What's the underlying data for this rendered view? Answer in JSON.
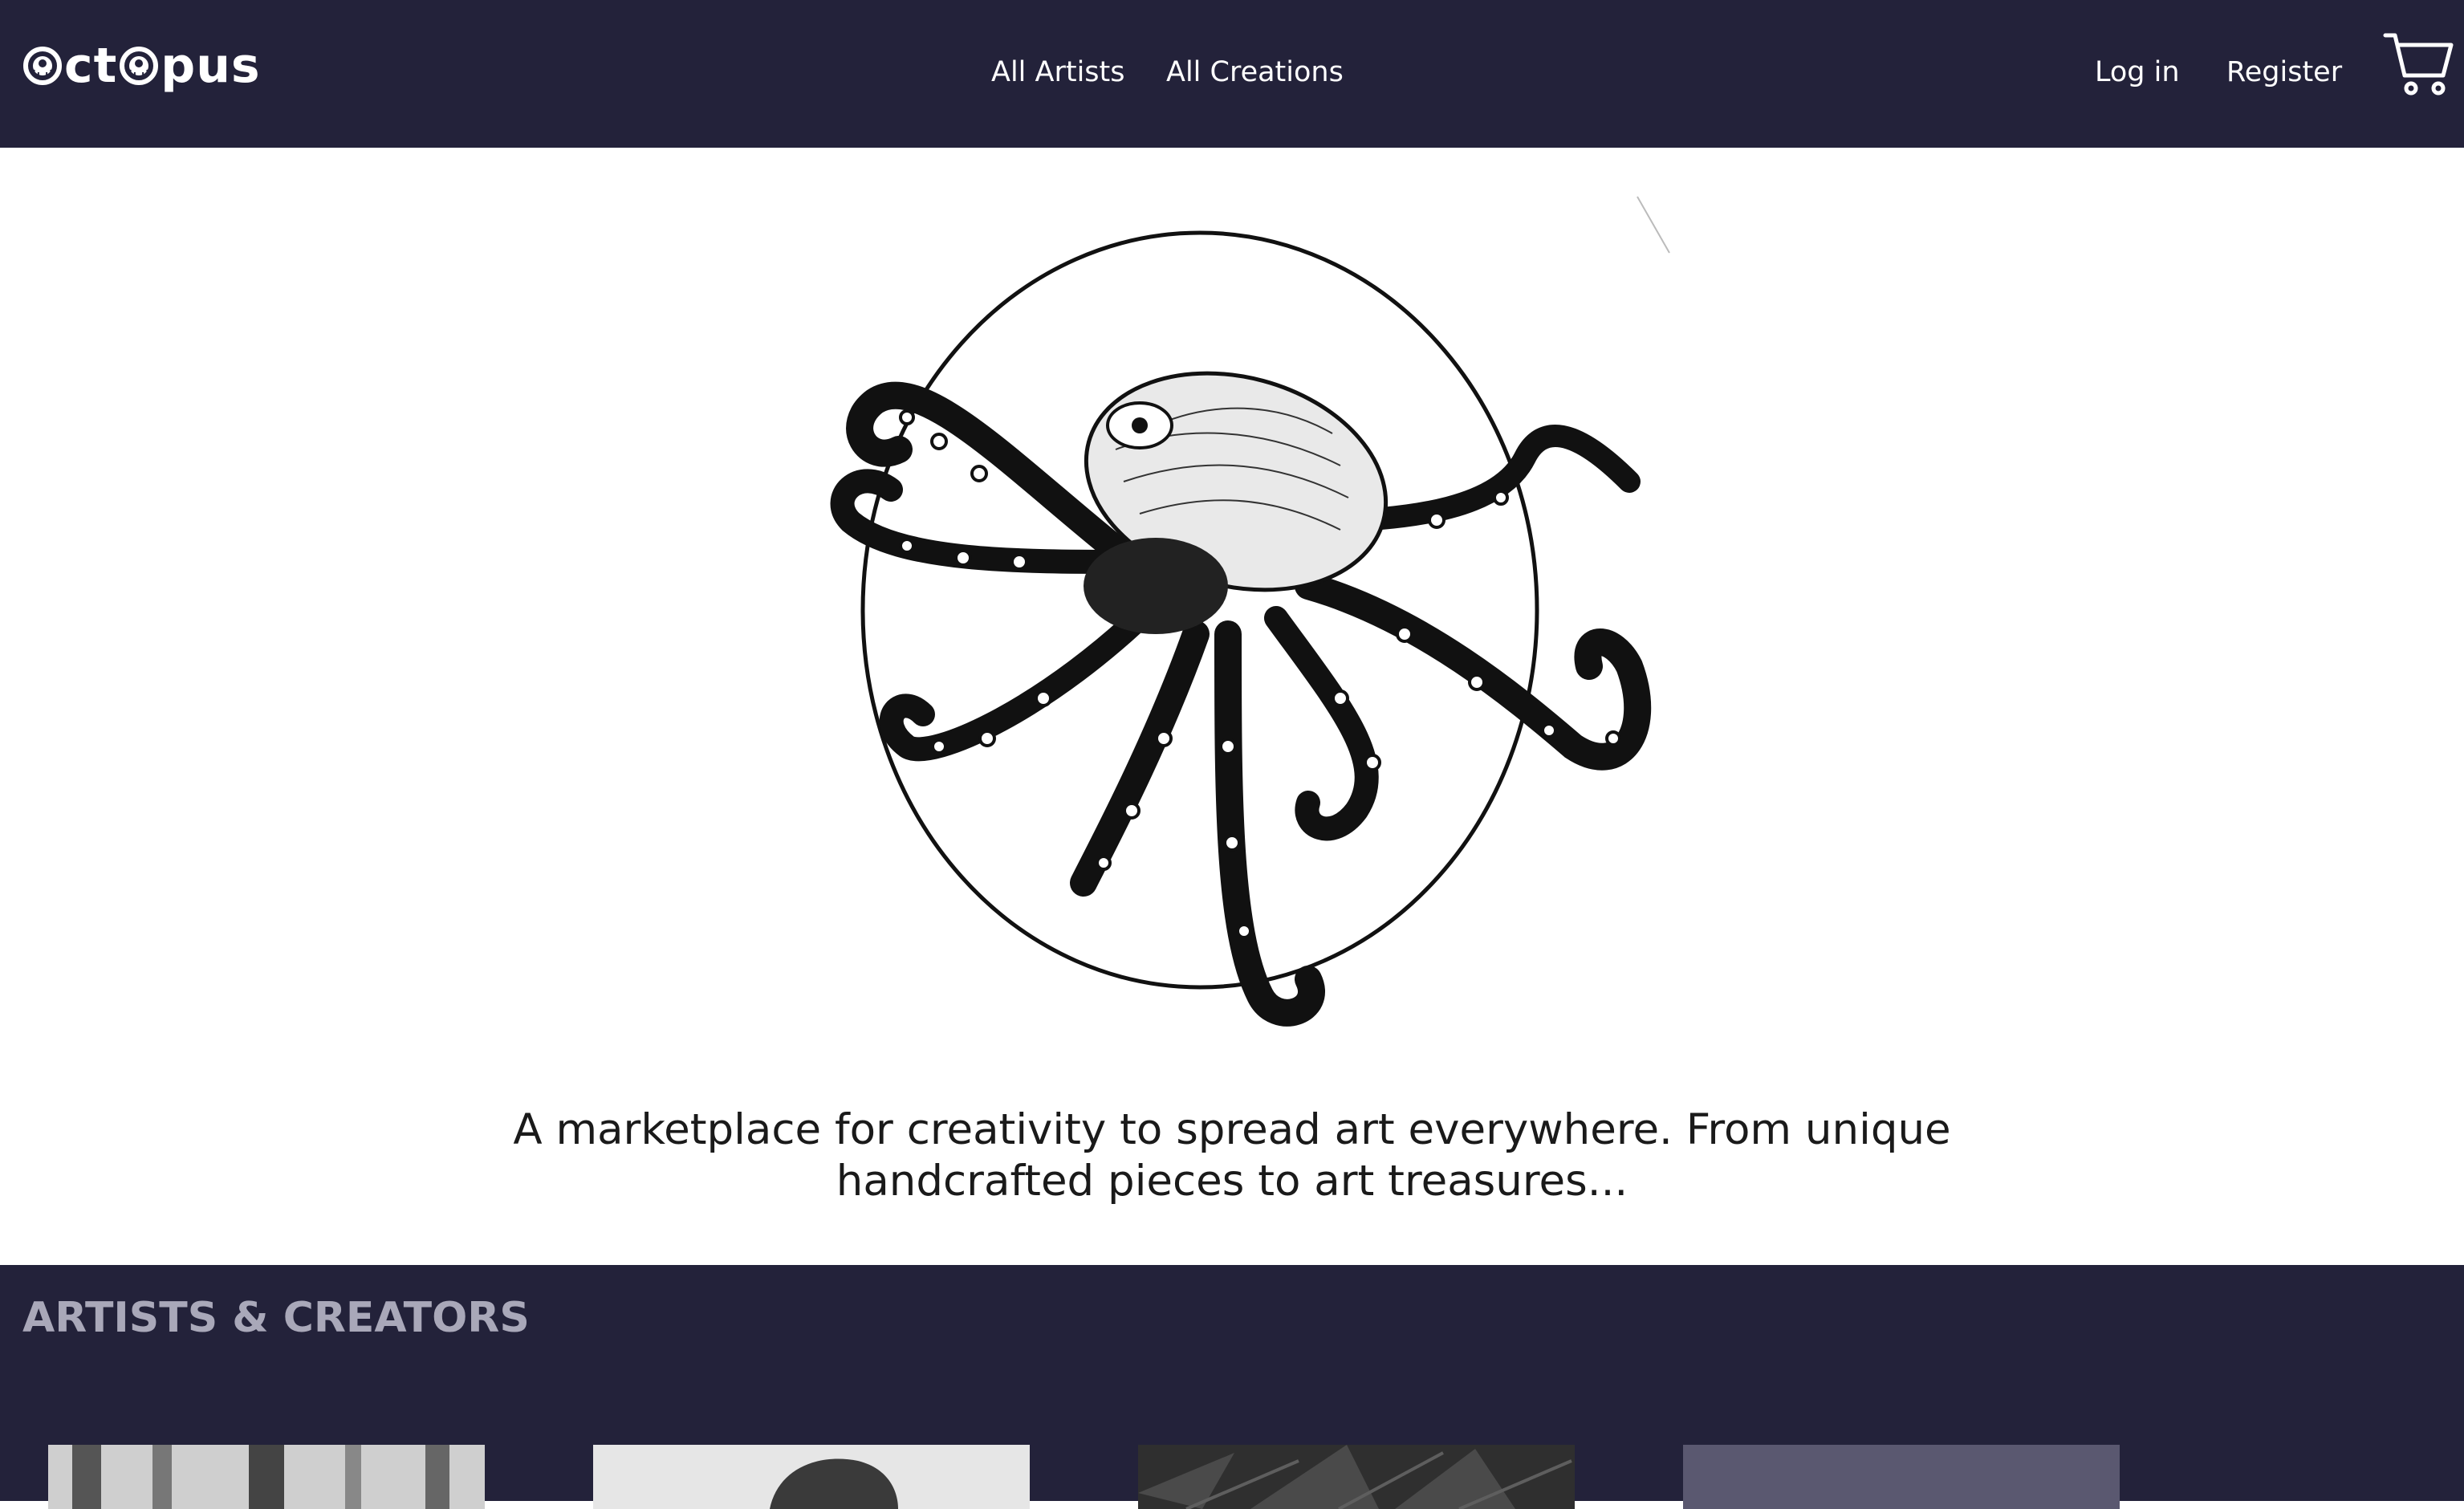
{
  "brand": {
    "logo_text_left": "ct",
    "logo_text_right": "pus",
    "logo_icon": "octopus-emblem-icon"
  },
  "nav": {
    "links": [
      {
        "label": "All Artists"
      },
      {
        "label": "All Creations"
      }
    ],
    "auth": [
      {
        "label": "Log in"
      },
      {
        "label": "Register"
      }
    ],
    "cart_icon": "cart-icon"
  },
  "hero": {
    "image": "octopus-illustration",
    "tagline_line1": "A marketplace for creativity to spread art everywhere. From unique",
    "tagline_line2": "handcrafted pieces to art treasures..."
  },
  "artists": {
    "title": "ARTISTS & CREATORS",
    "cards": [
      {
        "image": "forest-photo"
      },
      {
        "image": "portrait-photo"
      },
      {
        "image": "palm-leaves-photo"
      },
      {
        "image": "placeholder-photo"
      }
    ]
  },
  "colors": {
    "navy": "#23223a",
    "section_title": "#a9a8b9",
    "white": "#ffffff",
    "text": "#1a1a1a"
  }
}
